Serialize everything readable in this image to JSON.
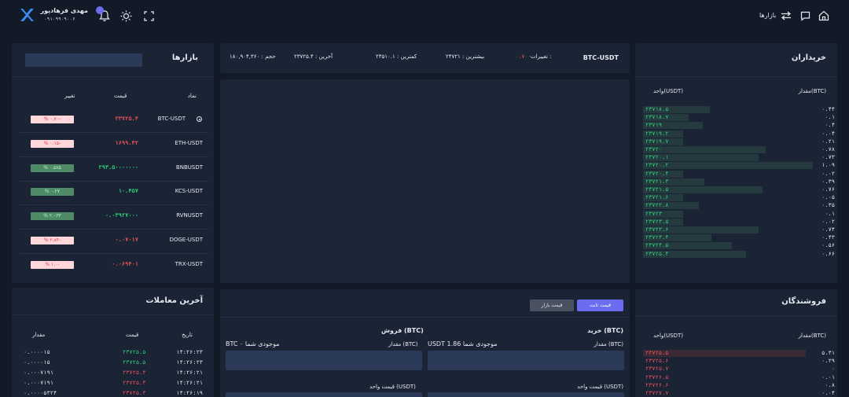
{
  "header": {
    "nav_markets": "بازارها",
    "user_name": "مهدی فرهادپور",
    "user_phone": "۰۹۱۰۹۹۰۹۰۰۶",
    "notif_count": "۰"
  },
  "markets": {
    "title": "بازارها",
    "col_symbol": "نماد",
    "col_price": "قیمت",
    "col_change": "تغییر",
    "rows": [
      {
        "symbol": "BTC-USDT",
        "price": "۲۳۷۲۵.۴",
        "change": "% ۰.۷۰-",
        "dir": "down"
      },
      {
        "symbol": "ETH-USDT",
        "price": "۱۶۹۹.۴۲",
        "change": "% ۰.۱۵-",
        "dir": "down"
      },
      {
        "symbol": "BNBUSDT",
        "price": "۲۹۳.۵۰۰۰۰۰۰۰",
        "change": "% ۰.۵۸۵",
        "dir": "up"
      },
      {
        "symbol": "KCS-USDT",
        "price": "۱۰.۴۵۷",
        "change": "% ۰.۲۷",
        "dir": "up"
      },
      {
        "symbol": "RVNUSDT",
        "price": "۰.۰۳۹۲۷۰۰۰",
        "change": "% ۲.۰۳۳",
        "dir": "up"
      },
      {
        "symbol": "DOGE-USDT",
        "price": "۰.۰۷۰۱۷",
        "change": "% ۲.۸۴-",
        "dir": "down"
      },
      {
        "symbol": "TRX-USDT",
        "price": "۰.۰۶۹۴۰۱",
        "change": "% ۱.۰-",
        "dir": "down"
      }
    ]
  },
  "ticker": {
    "pair": "BTC-USDT",
    "change_label": "تغییرات :",
    "change_value": "۰.۷۰-",
    "high": "بیشترین : ۲۴۷۲۱",
    "low": "کمترین : ۲۳۵۱۰.۱",
    "last": "آخرین : ۲۳۷۲۵.۴",
    "volume": "حجم : ۱۸۰,۹۰۴,۳۶۰"
  },
  "buyers": {
    "title": "خریداران",
    "col_amount": "مقدار(BTC)",
    "col_price": "واحد(USDT)",
    "rows": [
      {
        "price": "۲۳۷۱۸.۵",
        "amount": "۰.۴۴",
        "bar": 0.37
      },
      {
        "price": "۲۳۷۱۸.۷",
        "amount": "۰.۱",
        "bar": 0.25
      },
      {
        "price": "۲۳۷۱۹",
        "amount": "۰.۴",
        "bar": 0.33
      },
      {
        "price": "۲۳۷۱۹.۲",
        "amount": "۰.۰۴",
        "bar": 0.22
      },
      {
        "price": "۲۳۷۱۹.۷",
        "amount": "۰.۲۱",
        "bar": 0.22
      },
      {
        "price": "۲۳۷۲۰",
        "amount": "۰.۷۸",
        "bar": 0.68
      },
      {
        "price": "۲۳۷۲۰.۱",
        "amount": "۰.۷۳",
        "bar": 0.64
      },
      {
        "price": "۲۳۷۲۰.۲",
        "amount": "۱.۰۹",
        "bar": 0.94
      },
      {
        "price": "۲۳۷۲۰.۴",
        "amount": "۰.۰۲",
        "bar": 0.22
      },
      {
        "price": "۲۳۷۲۱.۳",
        "amount": "۰.۳۹",
        "bar": 0.34
      },
      {
        "price": "۲۳۷۲۱.۵",
        "amount": "۰.۷۶",
        "bar": 0.66
      },
      {
        "price": "۲۳۷۲۱.۶",
        "amount": "۰.۰۵",
        "bar": 0.22
      },
      {
        "price": "۲۳۷۲۲.۸",
        "amount": "۰.۳۵",
        "bar": 0.31
      },
      {
        "price": "۲۳۷۲۳",
        "amount": "۰.۱",
        "bar": 0.22
      },
      {
        "price": "۲۳۷۲۳.۵",
        "amount": "۰.۰۲",
        "bar": 0.22
      },
      {
        "price": "۲۳۷۲۳.۶",
        "amount": "۰.۷۴",
        "bar": 0.64
      },
      {
        "price": "۲۳۷۲۴.۴",
        "amount": "۰.۴۳",
        "bar": 0.38
      },
      {
        "price": "۲۳۷۲۴.۵",
        "amount": "۰.۵۶",
        "bar": 0.49
      },
      {
        "price": "۲۳۷۲۵.۴",
        "amount": "۰.۶۶",
        "bar": 0.57
      }
    ]
  },
  "trades": {
    "title": "آخرین معاملات",
    "col_date": "تاریخ",
    "col_price": "قیمت",
    "col_amount": "مقدار",
    "rows": [
      {
        "time": "۱۴:۲۶:۲۳",
        "price": "۲۳۷۲۵.۵",
        "amount": "۰.۰۰۰۰۱۵",
        "dir": "up"
      },
      {
        "time": "۱۴:۲۶:۲۳",
        "price": "۲۳۷۲۵.۵",
        "amount": "۰.۰۰۰۰۱۵",
        "dir": "up"
      },
      {
        "time": "۱۴:۲۶:۲۱",
        "price": "۲۳۷۲۵.۴",
        "amount": "۰.۰۰۰۷۱۹۱",
        "dir": "down"
      },
      {
        "time": "۱۴:۲۶:۲۱",
        "price": "۲۳۷۲۵.۴",
        "amount": "۰.۰۰۰۷۱۹۱",
        "dir": "down"
      },
      {
        "time": "۱۴:۲۶:۱۹",
        "price": "۲۳۷۲۵.۴",
        "amount": "۰.۰۰۰۰۵۳۲۴",
        "dir": "down"
      }
    ]
  },
  "order": {
    "tab_limit": "قیمت ثابت",
    "tab_market": "قیمت بازار",
    "buy_title": "خرید (BTC)",
    "sell_title": "فروش (BTC)",
    "buy_amount_label": "مقدار (BTC)",
    "buy_balance": "موجودی شما 1.86 USDT",
    "sell_amount_label": "مقدار (BTC)",
    "sell_balance": "موجودی شما ۰ BTC",
    "buy_price_label": "قیمت واحد (USDT)",
    "sell_price_label": "قیمت واحد (USDT)"
  },
  "sellers": {
    "title": "فروشندگان",
    "col_amount": "مقدار(BTC)",
    "col_price": "واحد(USDT)",
    "rows": [
      {
        "price": "۲۳۷۲۵.۵",
        "amount": "۵.۳۱",
        "bar": 0.9
      },
      {
        "price": "۲۳۷۲۵.۶",
        "amount": "۰.۲۹",
        "bar": 0.0
      },
      {
        "price": "۲۳۷۲۵.۷",
        "amount": "۰",
        "bar": 0.0
      },
      {
        "price": "۲۳۷۲۶.۵",
        "amount": "۰.۰۱",
        "bar": 0.0
      },
      {
        "price": "۲۳۷۲۶.۶",
        "amount": "۰.۸",
        "bar": 0.0
      },
      {
        "price": "۲۳۷۲۷.۷",
        "amount": "۰.۰۴",
        "bar": 0.0
      }
    ]
  },
  "colors": {
    "green": "#2fd57a",
    "red": "#f2525e",
    "panel": "#1a2435",
    "accent": "#6b6cf0"
  }
}
